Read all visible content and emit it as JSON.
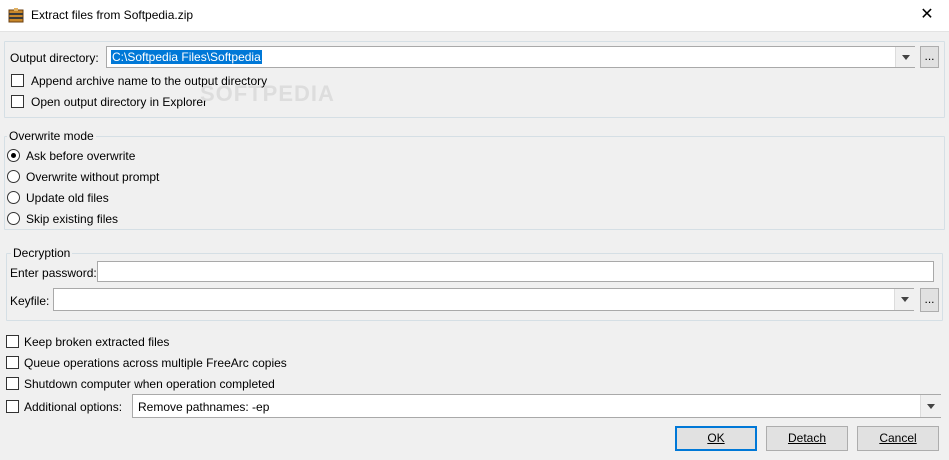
{
  "window": {
    "title": "Extract files from Softpedia.zip",
    "close_glyph": "✕"
  },
  "output": {
    "label": "Output directory:",
    "value": "C:\\Softpedia Files\\Softpedia",
    "browse_label": "...",
    "append_archive_name": {
      "label": "Append archive name to the output directory",
      "checked": false
    },
    "open_in_explorer": {
      "label": "Open output directory in Explorer",
      "checked": false
    }
  },
  "watermark": "SOFTPEDIA",
  "overwrite": {
    "legend": "Overwrite mode",
    "options": [
      {
        "label": "Ask before overwrite",
        "selected": true
      },
      {
        "label": "Overwrite without prompt",
        "selected": false
      },
      {
        "label": "Update old files",
        "selected": false
      },
      {
        "label": "Skip existing files",
        "selected": false
      }
    ]
  },
  "decryption": {
    "legend": "Decryption",
    "password_label": "Enter password:",
    "password_value": "",
    "keyfile_label": "Keyfile:",
    "keyfile_value": "",
    "browse_label": "..."
  },
  "options": {
    "keep_broken": {
      "label": "Keep broken extracted files",
      "checked": false
    },
    "queue_ops": {
      "label": "Queue operations across multiple FreeArc copies",
      "checked": false
    },
    "shutdown": {
      "label": "Shutdown computer when operation completed",
      "checked": false
    },
    "additional": {
      "label": "Additional options:",
      "checked": false,
      "value": "Remove pathnames: -ep"
    }
  },
  "buttons": {
    "ok": "OK",
    "detach": "Detach",
    "cancel": "Cancel"
  },
  "colors": {
    "selection": "#0078d7",
    "background": "#f0f0f0",
    "default_button_border": "#0078d7"
  }
}
